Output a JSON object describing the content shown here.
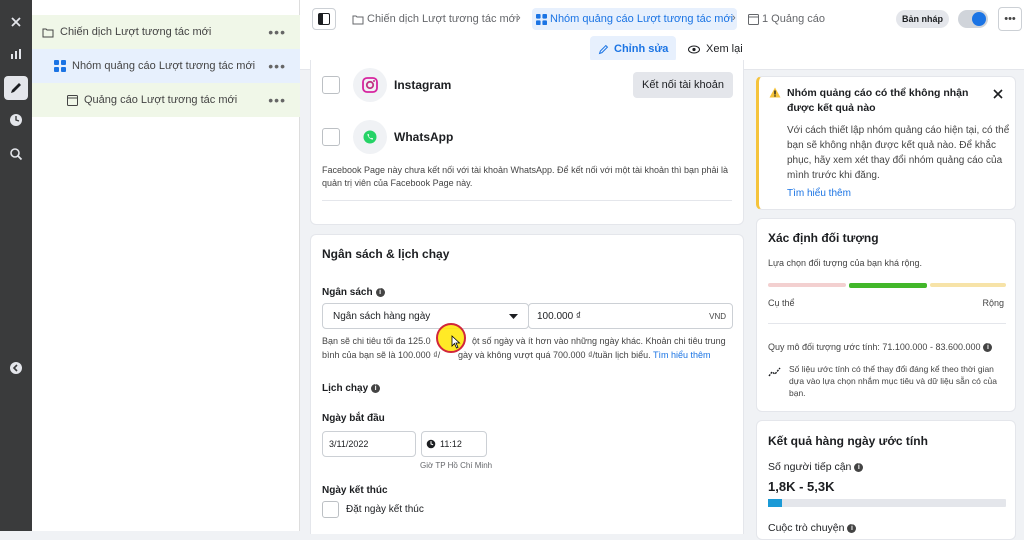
{
  "rail": {
    "icons": [
      "close-icon",
      "chart-icon",
      "pencil-icon",
      "clock-icon",
      "search-zoom-icon",
      "chevron-left-icon"
    ]
  },
  "tree": {
    "campaign": {
      "label": "Chiến dịch Lượt tương tác mới",
      "more": "•••"
    },
    "adset": {
      "label": "Nhóm quảng cáo Lượt tương tác mới",
      "more": "•••"
    },
    "ad": {
      "label": "Quảng cáo Lượt tương tác mới",
      "more": "•••"
    }
  },
  "topbar": {
    "crumb_campaign": "Chiến dịch Lượt tương tác mới",
    "crumb_adset": "Nhóm quảng cáo Lượt tương tác mới",
    "crumb_ad": "1 Quảng cáo",
    "draft_badge": "Bản nháp",
    "more": "•••",
    "edit_label": "Chỉnh sửa",
    "preview_label": "Xem lại",
    "colors": {
      "accent": "#1b74e4",
      "toggle": "#1b74e4"
    }
  },
  "accounts": {
    "instagram": "Instagram",
    "connect_button": "Kết nối tài khoản",
    "whatsapp": "WhatsApp",
    "whatsapp_note": "Facebook Page này chưa kết nối với tài khoản WhatsApp. Để kết nối với một tài khoản thì bạn phải là quản trị viên của Facebook Page này."
  },
  "budget": {
    "section_title": "Ngân sách & lịch chạy",
    "budget_label": "Ngân sách",
    "budget_type": "Ngân sách hàng ngày",
    "budget_value": "100.000 ₫",
    "currency": "VND",
    "note_prefix": "Bạn sẽ chi tiêu tối đa 125.0",
    "note_suffix": "ột số ngày và ít hơn vào những ngày khác. Khoản chi tiêu trung",
    "note_line2_prefix": "bình của bạn sẽ là 100.000 ₫/",
    "note_line2_suffix": "gày và không vượt quá 700.000 ₫/tuần lịch biểu.",
    "learn_more": "Tìm hiểu thêm",
    "schedule_label": "Lịch chạy",
    "start_label": "Ngày bắt đầu",
    "start_date": "3/11/2022",
    "start_time": "11:12",
    "timezone": "Giờ TP Hồ Chí Minh",
    "end_label": "Ngày kết thúc",
    "end_checkbox": "Đặt ngày kết thúc"
  },
  "warning": {
    "title": "Nhóm quảng cáo có thể không nhận được kết quả nào",
    "body": "Với cách thiết lập nhóm quảng cáo hiện tại, có thể bạn sẽ không nhận được kết quả nào. Để khắc phục, hãy xem xét thay đổi nhóm quảng cáo của mình trước khi đăng.",
    "learn_more": "Tìm hiểu thêm",
    "accent": "#f5c33b"
  },
  "audience": {
    "title": "Xác định đối tượng",
    "subtitle": "Lựa chọn đối tượng của bạn khá rộng.",
    "left": "Cụ thể",
    "right": "Rộng",
    "size": "Quy mô đối tượng ước tính: 71.100.000 - 83.600.000",
    "note": "Số liệu ước tính có thể thay đổi đáng kể theo thời gian dựa vào lựa chọn nhắm mục tiêu và dữ liệu sẵn có của bạn.",
    "colors": {
      "low": "#f3d0d0",
      "mid": "#42b72a",
      "high": "#f7e3a8"
    }
  },
  "results": {
    "title": "Kết quả hàng ngày ước tính",
    "reach_label": "Số người tiếp cận",
    "reach_value": "1,8K - 5,3K",
    "reach_fill": 0.06,
    "engagement_label": "Cuộc trò chuyện"
  }
}
